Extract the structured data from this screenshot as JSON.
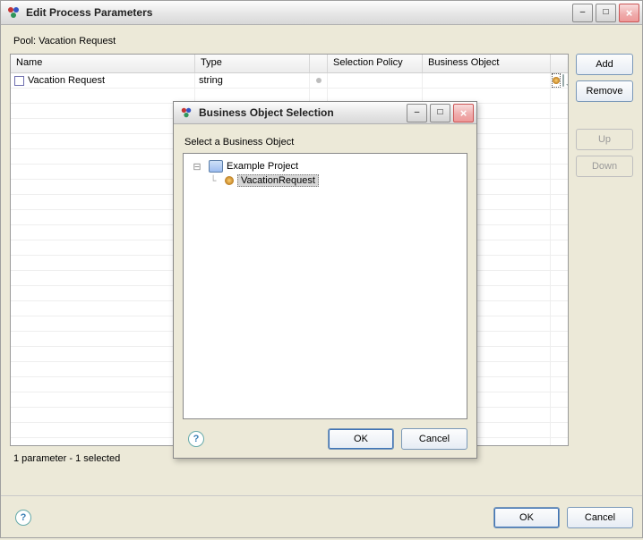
{
  "main": {
    "title": "Edit Process Parameters",
    "pool_prefix": "Pool: ",
    "pool_name": "Vacation Request",
    "columns": {
      "name": "Name",
      "type": "Type",
      "selection": "Selection Policy",
      "business": "Business Object"
    },
    "rows": [
      {
        "name": "Vacation Request",
        "type": "string"
      }
    ],
    "buttons": {
      "add": "Add",
      "remove": "Remove",
      "up": "Up",
      "down": "Down",
      "ok": "OK",
      "cancel": "Cancel"
    },
    "status": "1 parameter - 1  selected"
  },
  "modal": {
    "title": "Business Object Selection",
    "label": "Select a Business Object",
    "tree": {
      "project": "Example Project",
      "item": "VacationRequest"
    },
    "buttons": {
      "ok": "OK",
      "cancel": "Cancel"
    }
  },
  "glyphs": {
    "minimize": "–",
    "maximize": "□",
    "close": "×",
    "minus": "⊟",
    "help": "?"
  }
}
